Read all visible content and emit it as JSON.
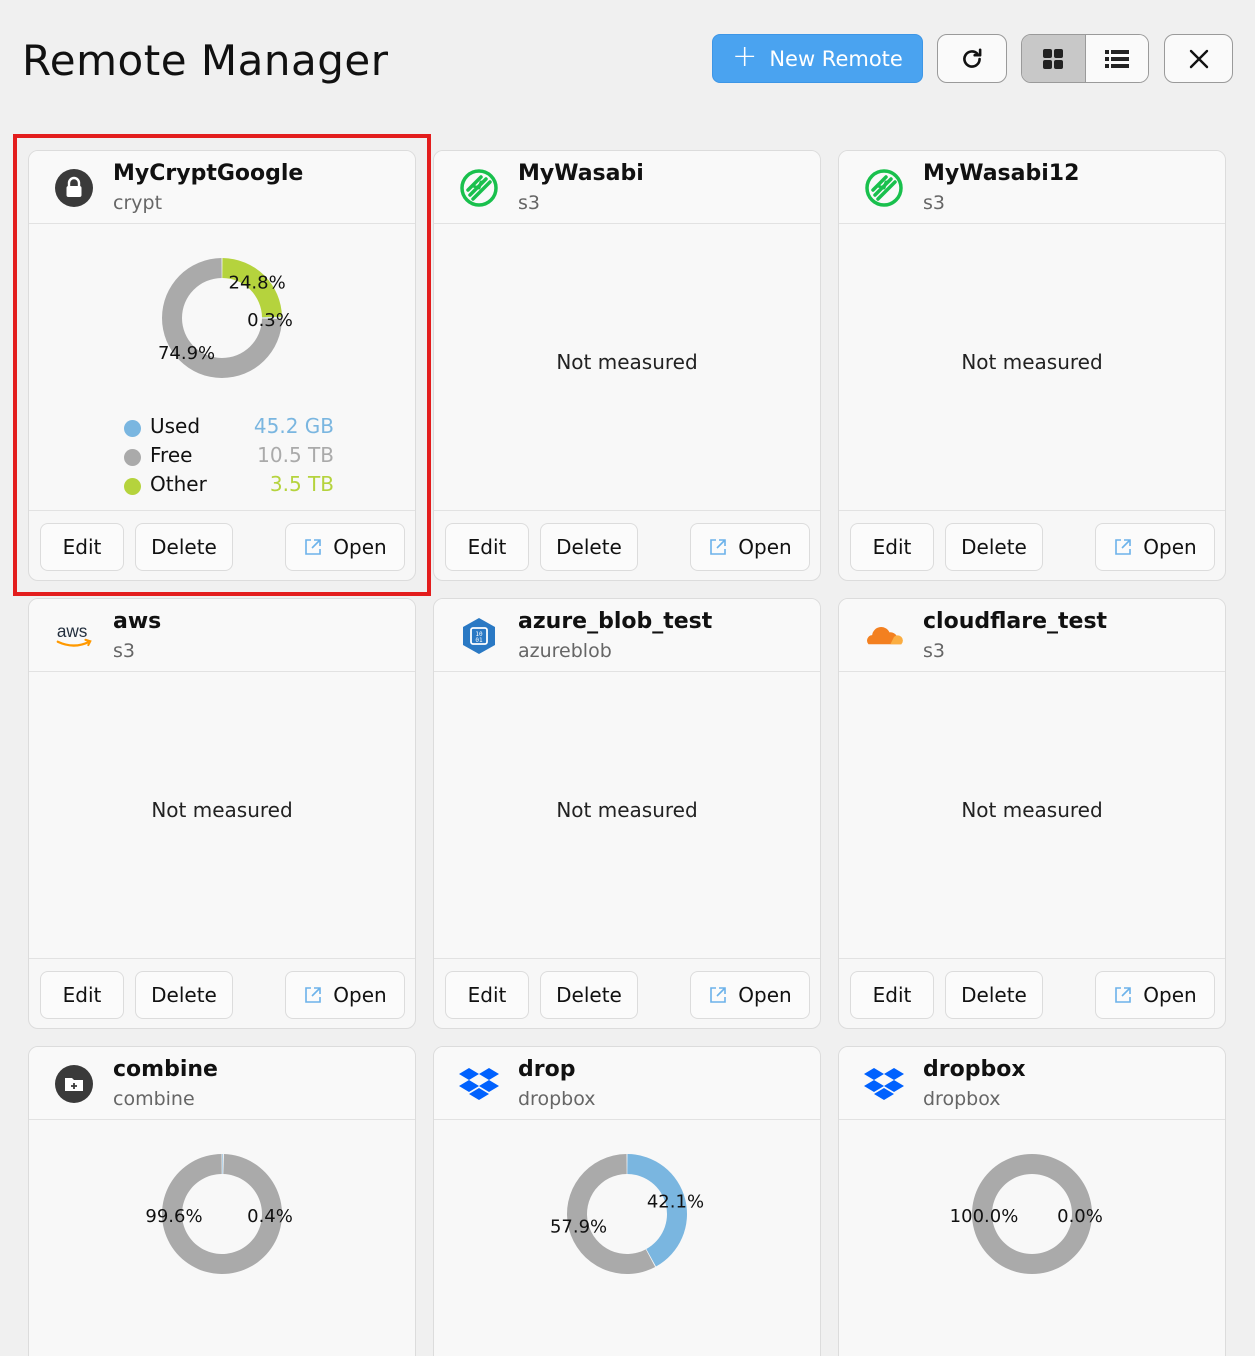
{
  "header": {
    "title": "Remote Manager",
    "new_remote_label": "New Remote"
  },
  "colors": {
    "used": "#7ab6e0",
    "free": "#aaaaaa",
    "other": "#b5d33d",
    "accent": "#4aa3f0",
    "highlight": "#e31d1d"
  },
  "actions": {
    "edit": "Edit",
    "delete": "Delete",
    "open": "Open"
  },
  "not_measured_label": "Not measured",
  "remotes": [
    {
      "name": "MyCryptGoogle",
      "type": "crypt",
      "icon": "lock-icon",
      "usage": {
        "used": 0.3,
        "free": 74.9,
        "other": 24.8
      },
      "labels": {
        "used": "0.3%",
        "free": "74.9%",
        "other": "24.8%"
      },
      "legend": [
        {
          "label": "Used",
          "value": "45.2 GB"
        },
        {
          "label": "Free",
          "value": "10.5 TB"
        },
        {
          "label": "Other",
          "value": "3.5 TB"
        }
      ]
    },
    {
      "name": "MyWasabi",
      "type": "s3",
      "icon": "wasabi-icon"
    },
    {
      "name": "MyWasabi12",
      "type": "s3",
      "icon": "wasabi-icon"
    },
    {
      "name": "aws",
      "type": "s3",
      "icon": "aws-icon"
    },
    {
      "name": "azure_blob_test",
      "type": "azureblob",
      "icon": "azure-blob-icon"
    },
    {
      "name": "cloudflare_test",
      "type": "s3",
      "icon": "cloudflare-icon"
    },
    {
      "name": "combine",
      "type": "combine",
      "icon": "folder-add-icon",
      "usage": {
        "used": 0.4,
        "free": 99.6,
        "other": 0
      },
      "labels": {
        "used": "0.4%",
        "free": "99.6%"
      }
    },
    {
      "name": "drop",
      "type": "dropbox",
      "icon": "dropbox-icon",
      "usage": {
        "used": 42.1,
        "free": 57.9,
        "other": 0
      },
      "labels": {
        "used": "42.1%",
        "free": "57.9%"
      }
    },
    {
      "name": "dropbox",
      "type": "dropbox",
      "icon": "dropbox-icon",
      "usage": {
        "used": 0.0,
        "free": 100.0,
        "other": 0
      },
      "labels": {
        "used": "0.0%",
        "free": "100.0%"
      }
    }
  ]
}
